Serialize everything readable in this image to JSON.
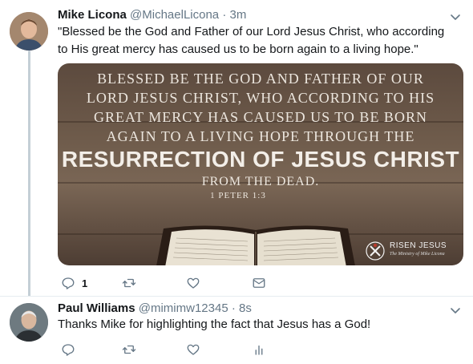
{
  "tweet1": {
    "name": "Mike Licona",
    "handle": "@MichaelLicona",
    "separator": "·",
    "time": "3m",
    "text": "\"Blessed be the God and Father of our Lord Jesus Christ, who according to His great mercy has caused us to be born again to a living hope.\"",
    "image_text": {
      "line1": "Blessed be the God and Father of our",
      "line2": "Lord Jesus Christ, who according to his",
      "line3": "great mercy has caused us to be born",
      "line4": "again to a living hope through the",
      "line5": "Resurrection of Jesus Christ",
      "line6": "from the dead.",
      "reference": "1 Peter 1:3"
    },
    "logo": {
      "title": "RISEN JESUS",
      "subtitle": "The Ministry of Mike Licona"
    },
    "reply_count": "1"
  },
  "tweet2": {
    "name": "Paul Williams",
    "handle": "@mimimw12345",
    "separator": "·",
    "time": "8s",
    "text": "Thanks Mike for highlighting the fact that Jesus has a God!"
  },
  "colors": {
    "secondary_text": "#657786",
    "thread_line": "#c4cfd6",
    "divider": "#e6ecf0"
  },
  "icons": [
    "reply-icon",
    "retweet-icon",
    "like-icon",
    "dm-icon",
    "analytics-icon",
    "chevron-down-icon"
  ]
}
